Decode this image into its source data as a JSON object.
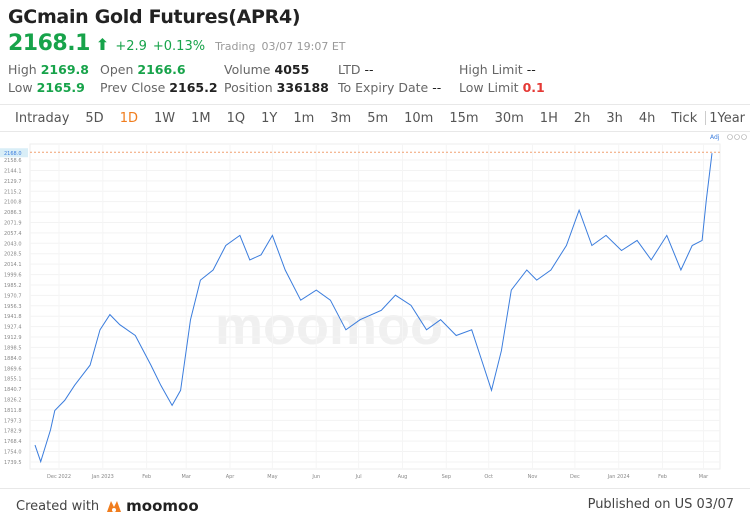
{
  "header": {
    "title": "GCmain Gold Futures(APR4)",
    "price": "2168.1",
    "arrow": "⬆",
    "change": "+2.9",
    "change_pct": "+0.13%",
    "status": "Trading",
    "timestamp": "03/07 19:07 ET"
  },
  "stats": {
    "high": {
      "label": "High",
      "value": "2169.8"
    },
    "low": {
      "label": "Low",
      "value": "2165.9"
    },
    "open": {
      "label": "Open",
      "value": "2166.6"
    },
    "prev_close": {
      "label": "Prev Close",
      "value": "2165.2"
    },
    "volume": {
      "label": "Volume",
      "value": "4055"
    },
    "position": {
      "label": "Position",
      "value": "336188"
    },
    "ltd": {
      "label": "LTD",
      "value": "--"
    },
    "expiry": {
      "label": "To Expiry Date",
      "value": "--"
    },
    "high_limit": {
      "label": "High Limit",
      "value": "--"
    },
    "low_limit": {
      "label": "Low Limit",
      "value": "0.1"
    }
  },
  "tabs": [
    "Intraday",
    "5D",
    "1D",
    "1W",
    "1M",
    "1Q",
    "1Y",
    "1m",
    "3m",
    "5m",
    "10m",
    "15m",
    "30m",
    "1H",
    "2h",
    "3h",
    "4h",
    "Tick"
  ],
  "active_tab": "1D",
  "range_label": "1Year : 1D",
  "colors": {
    "up": "#17a34a",
    "accent": "#f07d1e",
    "line": "#3b7ddd",
    "down": "#e53935"
  },
  "chart_data": {
    "type": "line",
    "adj_label": "Adj",
    "current_price_label": "2168.0",
    "ylim": [
      1739.5,
      2158.6
    ],
    "y_ticks": [
      "1739.5",
      "1754.0",
      "1768.4",
      "1782.9",
      "1797.3",
      "1811.8",
      "1826.2",
      "1840.7",
      "1855.1",
      "1869.6",
      "1884.0",
      "1898.5",
      "1912.9",
      "1927.4",
      "1941.8",
      "1956.3",
      "1970.7",
      "1985.2",
      "1999.6",
      "2014.1",
      "2028.5",
      "2043.0",
      "2057.4",
      "2071.9",
      "2086.3",
      "2100.8",
      "2115.2",
      "2129.7",
      "2144.1",
      "2158.6"
    ],
    "x_ticks": [
      {
        "label": "Dec 2022",
        "date": "2022-12-01"
      },
      {
        "label": "Jan 2023",
        "date": "2023-01-01"
      },
      {
        "label": "Feb",
        "date": "2023-02-01"
      },
      {
        "label": "Mar",
        "date": "2023-03-01"
      },
      {
        "label": "Apr",
        "date": "2023-04-01"
      },
      {
        "label": "May",
        "date": "2023-05-01"
      },
      {
        "label": "Jun",
        "date": "2023-06-01"
      },
      {
        "label": "Jul",
        "date": "2023-07-01"
      },
      {
        "label": "Aug",
        "date": "2023-08-01"
      },
      {
        "label": "Sep",
        "date": "2023-09-01"
      },
      {
        "label": "Oct",
        "date": "2023-10-01"
      },
      {
        "label": "Nov",
        "date": "2023-11-01"
      },
      {
        "label": "Dec",
        "date": "2023-12-01"
      },
      {
        "label": "Jan 2024",
        "date": "2024-01-01"
      },
      {
        "label": "Feb",
        "date": "2024-02-01"
      },
      {
        "label": "Mar",
        "date": "2024-03-01"
      }
    ],
    "xlim": [
      "2022-11-14",
      "2024-03-07"
    ],
    "series": [
      [
        "2022-11-14",
        1763
      ],
      [
        "2022-11-18",
        1740
      ],
      [
        "2022-11-25",
        1784
      ],
      [
        "2022-11-28",
        1811
      ],
      [
        "2022-12-05",
        1825
      ],
      [
        "2022-12-12",
        1846
      ],
      [
        "2022-12-23",
        1874
      ],
      [
        "2022-12-30",
        1923
      ],
      [
        "2023-01-06",
        1944
      ],
      [
        "2023-01-13",
        1930
      ],
      [
        "2023-01-24",
        1915
      ],
      [
        "2023-02-04",
        1874
      ],
      [
        "2023-02-11",
        1846
      ],
      [
        "2023-02-19",
        1818
      ],
      [
        "2023-02-25",
        1839
      ],
      [
        "2023-03-04",
        1937
      ],
      [
        "2023-03-11",
        1992
      ],
      [
        "2023-03-20",
        2006
      ],
      [
        "2023-03-29",
        2040
      ],
      [
        "2023-04-08",
        2054
      ],
      [
        "2023-04-15",
        2020
      ],
      [
        "2023-04-23",
        2027
      ],
      [
        "2023-05-01",
        2054
      ],
      [
        "2023-05-10",
        2006
      ],
      [
        "2023-05-21",
        1964
      ],
      [
        "2023-06-01",
        1978
      ],
      [
        "2023-06-11",
        1964
      ],
      [
        "2023-06-22",
        1923
      ],
      [
        "2023-07-02",
        1937
      ],
      [
        "2023-07-17",
        1950
      ],
      [
        "2023-07-27",
        1971
      ],
      [
        "2023-08-07",
        1957
      ],
      [
        "2023-08-18",
        1923
      ],
      [
        "2023-08-28",
        1937
      ],
      [
        "2023-09-08",
        1915
      ],
      [
        "2023-09-19",
        1923
      ],
      [
        "2023-09-26",
        1881
      ],
      [
        "2023-10-03",
        1839
      ],
      [
        "2023-10-10",
        1894
      ],
      [
        "2023-10-17",
        1978
      ],
      [
        "2023-10-28",
        2006
      ],
      [
        "2023-11-04",
        1992
      ],
      [
        "2023-11-14",
        2006
      ],
      [
        "2023-11-25",
        2040
      ],
      [
        "2023-12-04",
        2089
      ],
      [
        "2023-12-13",
        2040
      ],
      [
        "2023-12-23",
        2054
      ],
      [
        "2024-01-03",
        2033
      ],
      [
        "2024-01-14",
        2047
      ],
      [
        "2024-01-24",
        2020
      ],
      [
        "2024-02-04",
        2054
      ],
      [
        "2024-02-14",
        2006
      ],
      [
        "2024-02-22",
        2040
      ],
      [
        "2024-02-29",
        2047
      ],
      [
        "2024-03-03",
        2103
      ],
      [
        "2024-03-07",
        2168
      ]
    ]
  },
  "watermark": "moomoo",
  "footer": {
    "created": "Created with",
    "brand": "moomoo",
    "published": "Published on US 03/07"
  }
}
